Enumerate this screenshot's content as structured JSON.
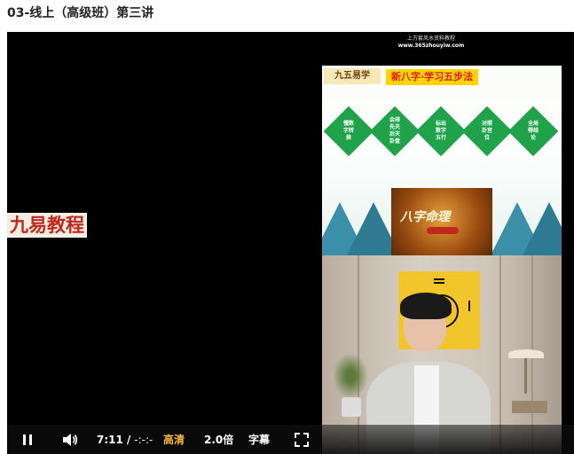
{
  "page": {
    "title": "03-线上（高级班）第三讲"
  },
  "video": {
    "watermark": "九易教程",
    "site_header": "上万套风水资料教程",
    "site_url": "www.365zhouyiw.com",
    "slide": {
      "logo": "九五易学",
      "title": "新八字·学习五步法",
      "steps": [
        "懂数字转换",
        "会排先天后天卦盘",
        "标出数字五行",
        "对照卦宫位",
        "全局得结论"
      ],
      "book_title": "八字命理",
      "colors": {
        "step": "#1fa24a",
        "title_bg": "#ffd400",
        "title_text": "#e0191e"
      }
    }
  },
  "controls": {
    "pause_icon": "pause-icon",
    "volume_icon": "volume-icon",
    "current_time": "7:11",
    "separator": "/",
    "duration": "-:-:-",
    "quality": "高清",
    "speed": "2.0倍",
    "subtitles": "字幕",
    "fullscreen_icon": "fullscreen-icon",
    "accent_color": "#f5b93a"
  }
}
